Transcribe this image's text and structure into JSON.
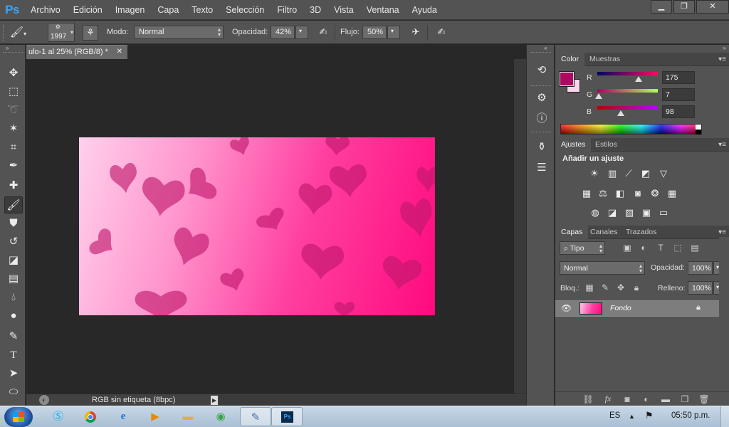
{
  "app": {
    "logo": "Ps"
  },
  "menu": [
    "Archivo",
    "Edición",
    "Imagen",
    "Capa",
    "Texto",
    "Selección",
    "Filtro",
    "3D",
    "Vista",
    "Ventana",
    "Ayuda"
  ],
  "window_controls": {
    "minimize": "▁",
    "restore": "❐",
    "close": "✕"
  },
  "options": {
    "brush_size": "1997",
    "mode_label": "Modo:",
    "mode_value": "Normal",
    "opacity_label": "Opacidad:",
    "opacity_value": "42%",
    "flow_label": "Flujo:",
    "flow_value": "50%"
  },
  "document": {
    "tab_title": "ulo-1 al 25% (RGB/8) *",
    "status": "RGB sin etiqueta (8bpc)"
  },
  "tools": [
    "move-icon",
    "marquee-icon",
    "lasso-icon",
    "magic-wand-icon",
    "crop-icon",
    "eyedropper-icon",
    "healing-brush-icon",
    "brush-icon",
    "clone-stamp-icon",
    "history-brush-icon",
    "eraser-icon",
    "gradient-icon",
    "blur-icon",
    "dodge-icon",
    "pen-icon",
    "type-icon",
    "path-selection-icon",
    "shape-icon"
  ],
  "color_panel": {
    "tabs": [
      "Color",
      "Muestras"
    ],
    "r_label": "R",
    "g_label": "G",
    "b_label": "B",
    "r": "175",
    "g": "7",
    "b": "98",
    "foreground": "#af0762",
    "background": "#f8d7ea",
    "r_level": 0.686,
    "g_level": 0.027,
    "b_level": 0.384
  },
  "adjustments_panel": {
    "tabs": [
      "Ajustes",
      "Estilos"
    ],
    "title": "Añadir un ajuste"
  },
  "layers_panel": {
    "tabs": [
      "Capas",
      "Canales",
      "Trazados"
    ],
    "filter_label": "Tipo",
    "blend_mode": "Normal",
    "opacity_label": "Opacidad:",
    "opacity_value": "100%",
    "lock_label": "Bloq.:",
    "fill_label": "Relleno:",
    "fill_value": "100%",
    "layers": [
      {
        "name": "Fondo",
        "visible": true,
        "locked": true
      }
    ]
  },
  "taskbar": {
    "language": "ES",
    "time": "05:50 p.m."
  }
}
